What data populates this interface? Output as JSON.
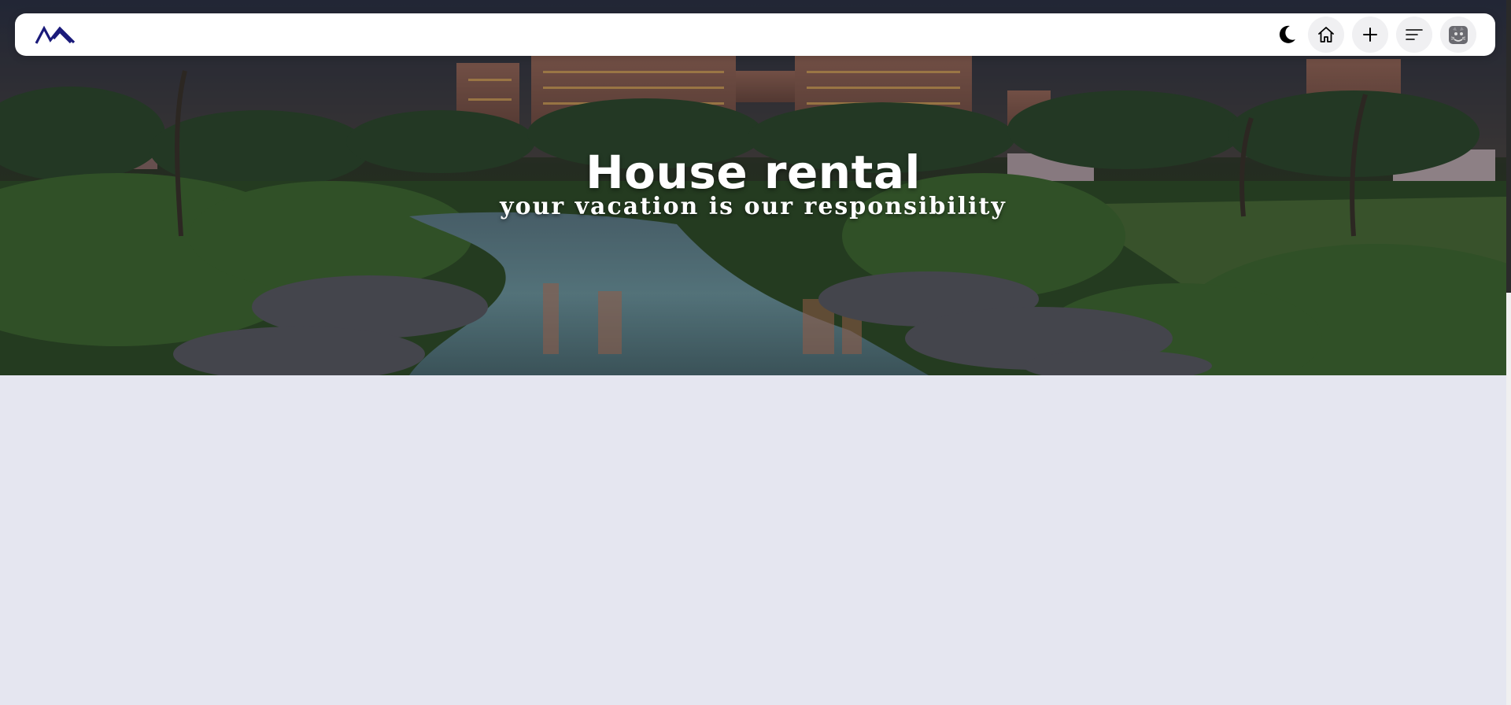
{
  "hero": {
    "title": "House rental",
    "subtitle": "your vacation is our responsibility"
  },
  "navbar": {
    "logo_icon": "mountain-logo-icon",
    "actions": [
      {
        "name": "theme-toggle",
        "icon": "moon-icon"
      },
      {
        "name": "home-button",
        "icon": "home-icon"
      },
      {
        "name": "add-button",
        "icon": "plus-icon"
      },
      {
        "name": "menu-button",
        "icon": "menu-lines-icon"
      },
      {
        "name": "avatar",
        "icon": "user-avatar-icon"
      }
    ]
  },
  "colors": {
    "page_background": "#e5e6f0",
    "navbar_background": "#ffffff",
    "logo": "#1a1a7a",
    "button_background": "#f0f0f2",
    "hero_text": "#ffffff"
  }
}
